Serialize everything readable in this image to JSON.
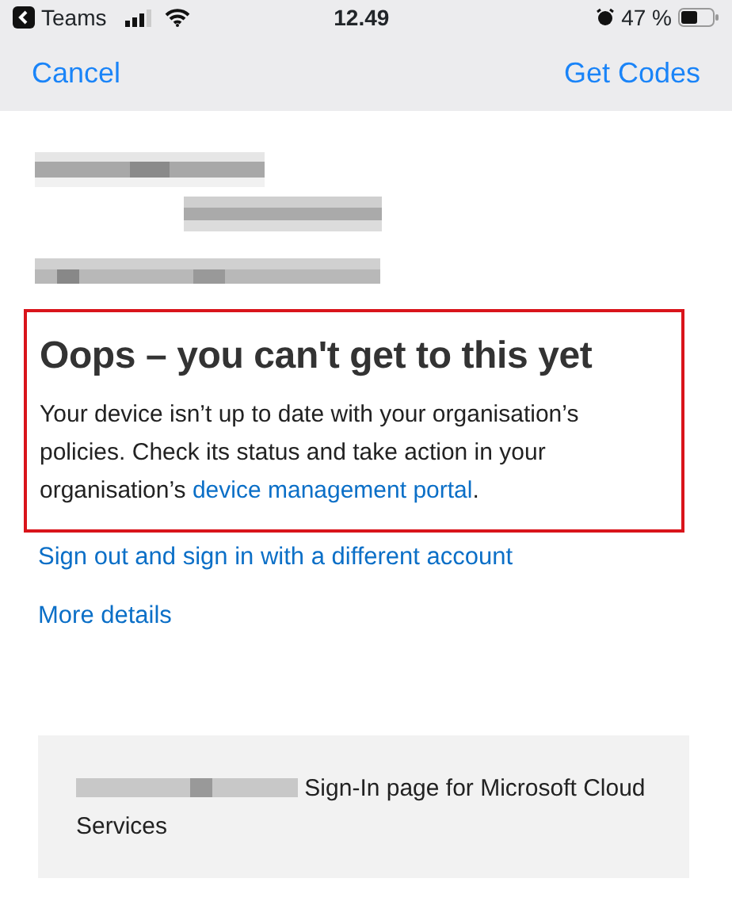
{
  "status_bar": {
    "back_app": "Teams",
    "time": "12.49",
    "battery": "47 %"
  },
  "nav": {
    "left": "Cancel",
    "right": "Get Codes"
  },
  "error": {
    "title": "Oops – you can't get to this yet",
    "message_before": "Your device isn’t up to date with your organisation’s policies. Check its status and take action in your organisation’s ",
    "link": "device management portal",
    "message_after": "."
  },
  "links": [
    "Sign out and sign in with a different account",
    "More details"
  ],
  "footer": {
    "text": "Sign-In page for Microsoft Cloud Services"
  }
}
